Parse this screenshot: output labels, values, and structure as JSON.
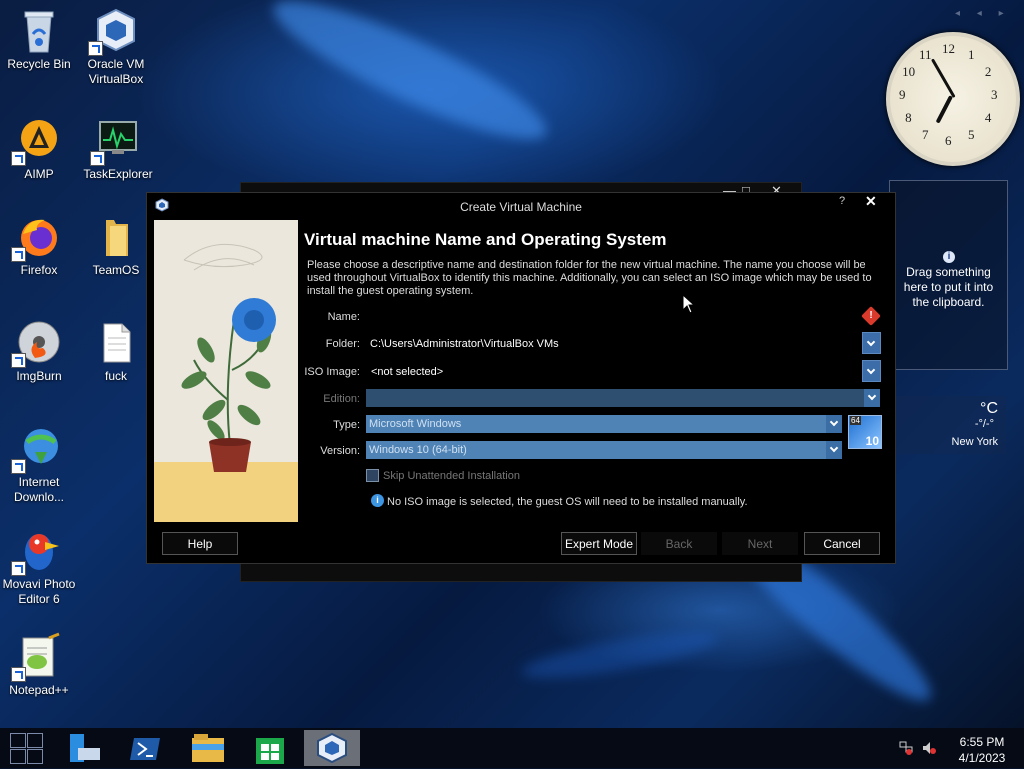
{
  "desktop": {
    "icons": [
      {
        "label": "Recycle Bin",
        "icon": "recycle-bin-icon"
      },
      {
        "label": "Oracle VM VirtualBox",
        "icon": "virtualbox-icon"
      },
      {
        "label": "AIMP",
        "icon": "aimp-icon"
      },
      {
        "label": "TaskExplorer",
        "icon": "task-explorer-icon"
      },
      {
        "label": "Firefox",
        "icon": "firefox-icon"
      },
      {
        "label": "TeamOS",
        "icon": "folder-icon"
      },
      {
        "label": "ImgBurn",
        "icon": "imgburn-icon"
      },
      {
        "label": "fuck",
        "icon": "text-file-icon"
      },
      {
        "label": "Internet Downlo...",
        "icon": "internet-download-manager-icon"
      },
      {
        "label": "Movavi Photo Editor 6",
        "icon": "movavi-icon"
      },
      {
        "label": "Notepad++",
        "icon": "notepad-plus-plus-icon"
      }
    ]
  },
  "gadgets": {
    "clipboard_text": "Drag something here to put it into the clipboard.",
    "clipboard_info_glyph": "i",
    "weather_temp": "°C",
    "weather_condition": "-°/-°",
    "weather_city": "New York",
    "clock": {
      "hour": 6,
      "minute": 55
    },
    "clock_numbers": [
      "12",
      "1",
      "2",
      "3",
      "4",
      "5",
      "6",
      "7",
      "8",
      "9",
      "10",
      "11"
    ]
  },
  "dialog": {
    "title": "Create Virtual Machine",
    "help_glyph": "?",
    "close_glyph": "✕",
    "heading": "Virtual machine Name and Operating System",
    "description": "Please choose a descriptive name and destination folder for the new virtual machine. The name you choose will be used throughout VirtualBox to identify this machine. Additionally, you can select an ISO image which may be used to install the guest operating system.",
    "fields": {
      "name_label": "Name:",
      "name_value": "",
      "folder_label": "Folder:",
      "folder_value": "C:\\Users\\Administrator\\VirtualBox VMs",
      "iso_label": "ISO Image:",
      "iso_value": "<not selected>",
      "edition_label": "Edition:",
      "edition_value": "",
      "type_label": "Type:",
      "type_value": "Microsoft Windows",
      "version_label": "Version:",
      "version_value": "Windows 10 (64-bit)",
      "os_badge_bits": "64",
      "os_badge_version": "10"
    },
    "warning_glyph": "!",
    "skip_unattended_label": "Skip Unattended Installation",
    "skip_unattended_checked": false,
    "hint_glyph": "i",
    "hint": "No ISO image is selected, the guest OS will need to be installed manually.",
    "buttons": {
      "help": "Help",
      "expert": "Expert Mode",
      "back": "Back",
      "next": "Next",
      "cancel": "Cancel"
    }
  },
  "bg_window_controls": [
    "—",
    "□",
    "✕"
  ],
  "sidebar_arrows": "◂ ◂ ▸",
  "taskbar": {
    "time": "6:55 PM",
    "date": "4/1/2023",
    "pinned": [
      "powershell-icon",
      "file-explorer-icon",
      "store-icon",
      "virtualbox-icon"
    ]
  },
  "colors": {
    "accent_blue": "#4f83b5",
    "warning_red": "#d93a2b"
  }
}
